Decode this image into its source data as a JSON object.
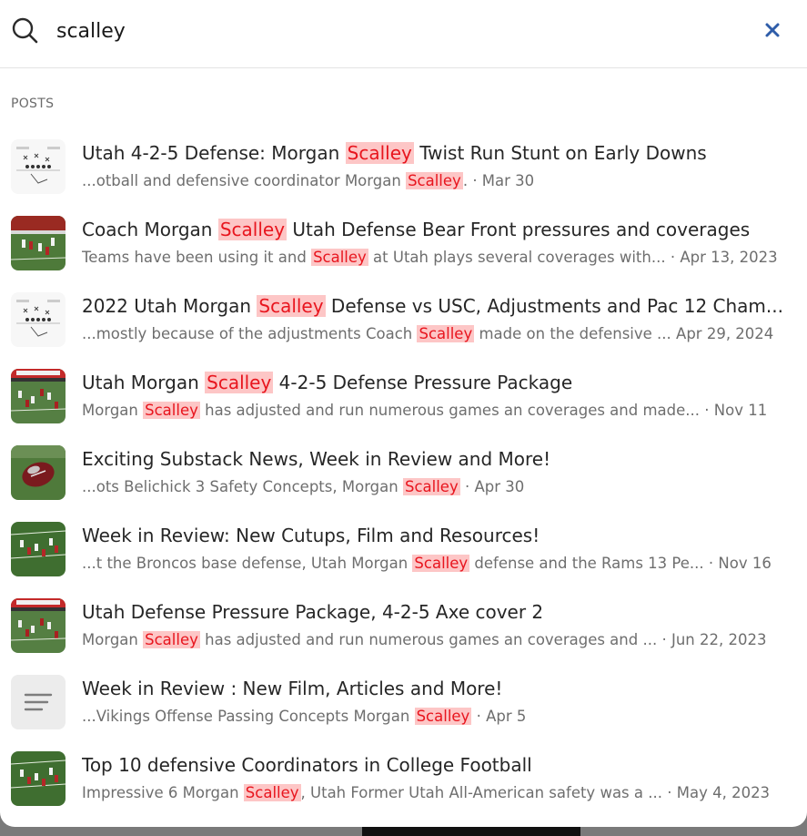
{
  "search": {
    "query": "scalley",
    "clear_label": "×"
  },
  "section": {
    "title": "POSTS"
  },
  "colors": {
    "highlight_bg": "#fdc6c6",
    "highlight_text": "#e8151e",
    "clear_icon": "#2f5da9"
  },
  "icons": {
    "search": "search-icon",
    "clear": "close-icon",
    "placeholder": "text-lines-icon"
  },
  "results": [
    {
      "title_pre": "Utah 4-2-5 Defense: Morgan ",
      "title_hl": "Scalley",
      "title_post": " Twist Run Stunt on Early Downs",
      "snippet_pre": "...otball and defensive coordinator Morgan ",
      "snippet_hl": "Scalley",
      "snippet_post": ".",
      "date": "· Mar 30",
      "thumb": "diagram"
    },
    {
      "title_pre": "Coach Morgan ",
      "title_hl": "Scalley",
      "title_post": " Utah Defense Bear Front pressures and coverages",
      "snippet_pre": "Teams have been using it and ",
      "snippet_hl": "Scalley",
      "snippet_post": " at Utah plays several coverages with...",
      "date": "· Apr 13, 2023",
      "thumb": "photo-red"
    },
    {
      "title_pre": "2022 Utah Morgan ",
      "title_hl": "Scalley",
      "title_post": " Defense vs USC, Adjustments and Pac 12 Cham...",
      "snippet_pre": "...mostly because of the adjustments Coach ",
      "snippet_hl": "Scalley",
      "snippet_post": " made on the defensive ...",
      "date": "Apr 29, 2024",
      "thumb": "diagram"
    },
    {
      "title_pre": "Utah Morgan ",
      "title_hl": "Scalley",
      "title_post": " 4-2-5 Defense Pressure Package",
      "snippet_pre": "Morgan ",
      "snippet_hl": "Scalley",
      "snippet_post": " has adjusted and run numerous games an coverages and made...",
      "date": "· Nov 11",
      "thumb": "photo-stadium"
    },
    {
      "title_pre": "Exciting Substack News, Week in Review and More!",
      "title_hl": "",
      "title_post": "",
      "snippet_pre": "...ots Belichick 3 Safety Concepts, Morgan ",
      "snippet_hl": "Scalley",
      "snippet_post": "",
      "date": "· Apr 30",
      "thumb": "photo-ball"
    },
    {
      "title_pre": "Week in Review: New Cutups, Film and Resources!",
      "title_hl": "",
      "title_post": "",
      "snippet_pre": "...t the Broncos base defense, Utah Morgan ",
      "snippet_hl": "Scalley",
      "snippet_post": " defense and the Rams 13 Pe...",
      "date": "· Nov 16",
      "thumb": "photo-field"
    },
    {
      "title_pre": "Utah Defense Pressure Package, 4-2-5 Axe cover 2",
      "title_hl": "",
      "title_post": "",
      "snippet_pre": "Morgan ",
      "snippet_hl": "Scalley",
      "snippet_post": " has adjusted and run numerous games an coverages and ...",
      "date": "· Jun 22, 2023",
      "thumb": "photo-stadium"
    },
    {
      "title_pre": "Week in Review : New Film, Articles and More!",
      "title_hl": "",
      "title_post": "",
      "snippet_pre": "...Vikings Offense Passing Concepts Morgan ",
      "snippet_hl": "Scalley",
      "snippet_post": "",
      "date": "· Apr 5",
      "thumb": "placeholder"
    },
    {
      "title_pre": "Top 10 defensive Coordinators in College Football",
      "title_hl": "",
      "title_post": "",
      "snippet_pre": "Impressive 6 Morgan ",
      "snippet_hl": "Scalley",
      "snippet_post": ", Utah Former Utah All-American safety was a ...",
      "date": "· May 4, 2023",
      "thumb": "photo-field"
    }
  ]
}
